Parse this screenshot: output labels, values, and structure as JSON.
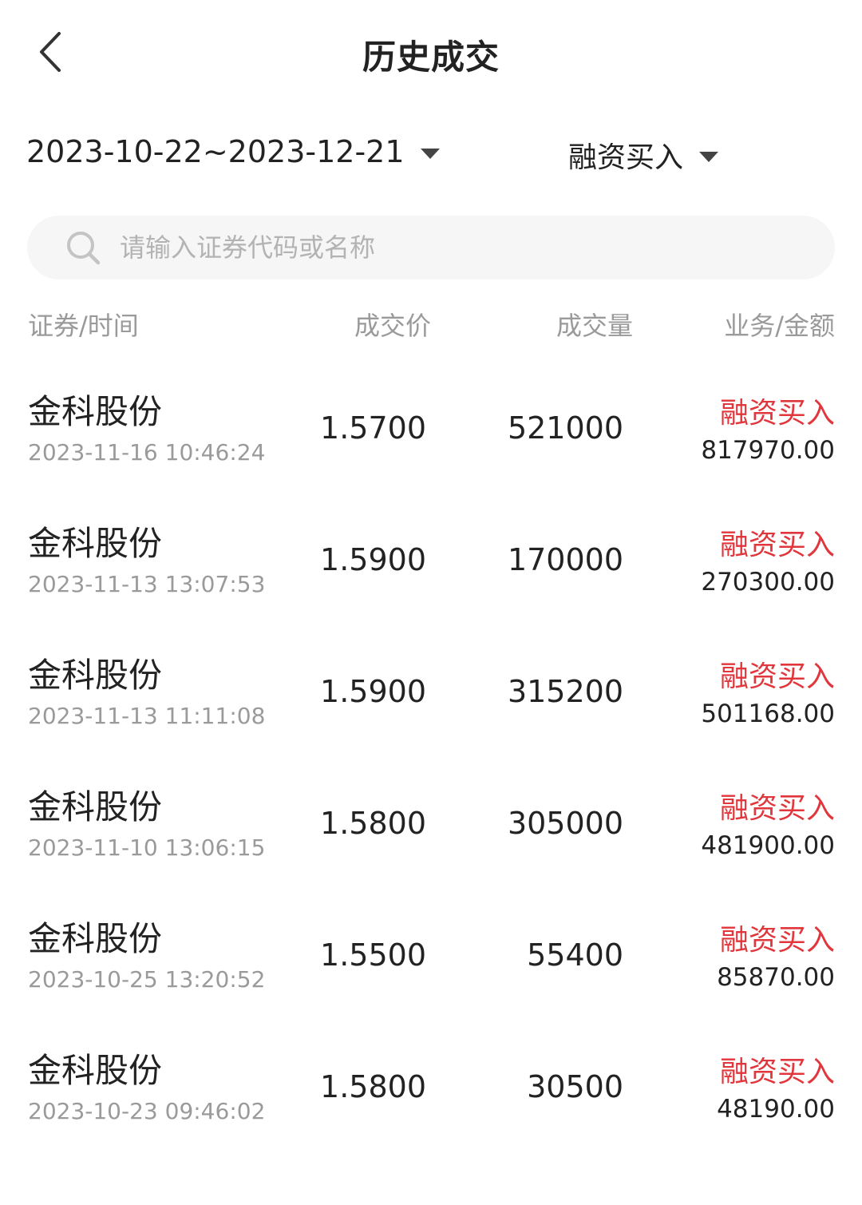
{
  "header": {
    "title": "历史成交"
  },
  "filters": {
    "date_range": "2023-10-22~2023-12-21",
    "trade_type": "融资买入"
  },
  "search": {
    "placeholder": "请输入证券代码或名称"
  },
  "columns": {
    "security_time": "证券/时间",
    "price": "成交价",
    "volume": "成交量",
    "business_amount": "业务/金额"
  },
  "trades": [
    {
      "name": "金科股份",
      "time": "2023-11-16 10:46:24",
      "price": "1.5700",
      "volume": "521000",
      "business": "融资买入",
      "amount": "817970.00"
    },
    {
      "name": "金科股份",
      "time": "2023-11-13 13:07:53",
      "price": "1.5900",
      "volume": "170000",
      "business": "融资买入",
      "amount": "270300.00"
    },
    {
      "name": "金科股份",
      "time": "2023-11-13 11:11:08",
      "price": "1.5900",
      "volume": "315200",
      "business": "融资买入",
      "amount": "501168.00"
    },
    {
      "name": "金科股份",
      "time": "2023-11-10 13:06:15",
      "price": "1.5800",
      "volume": "305000",
      "business": "融资买入",
      "amount": "481900.00"
    },
    {
      "name": "金科股份",
      "time": "2023-10-25 13:20:52",
      "price": "1.5500",
      "volume": "55400",
      "business": "融资买入",
      "amount": "85870.00"
    },
    {
      "name": "金科股份",
      "time": "2023-10-23 09:46:02",
      "price": "1.5800",
      "volume": "30500",
      "business": "融资买入",
      "amount": "48190.00"
    }
  ],
  "colors": {
    "business_red": "#e0363c",
    "muted_gray": "#9a9a9a"
  },
  "icons": {
    "back": "chevron-left-icon",
    "search": "search-icon",
    "dropdown": "caret-down-icon"
  }
}
